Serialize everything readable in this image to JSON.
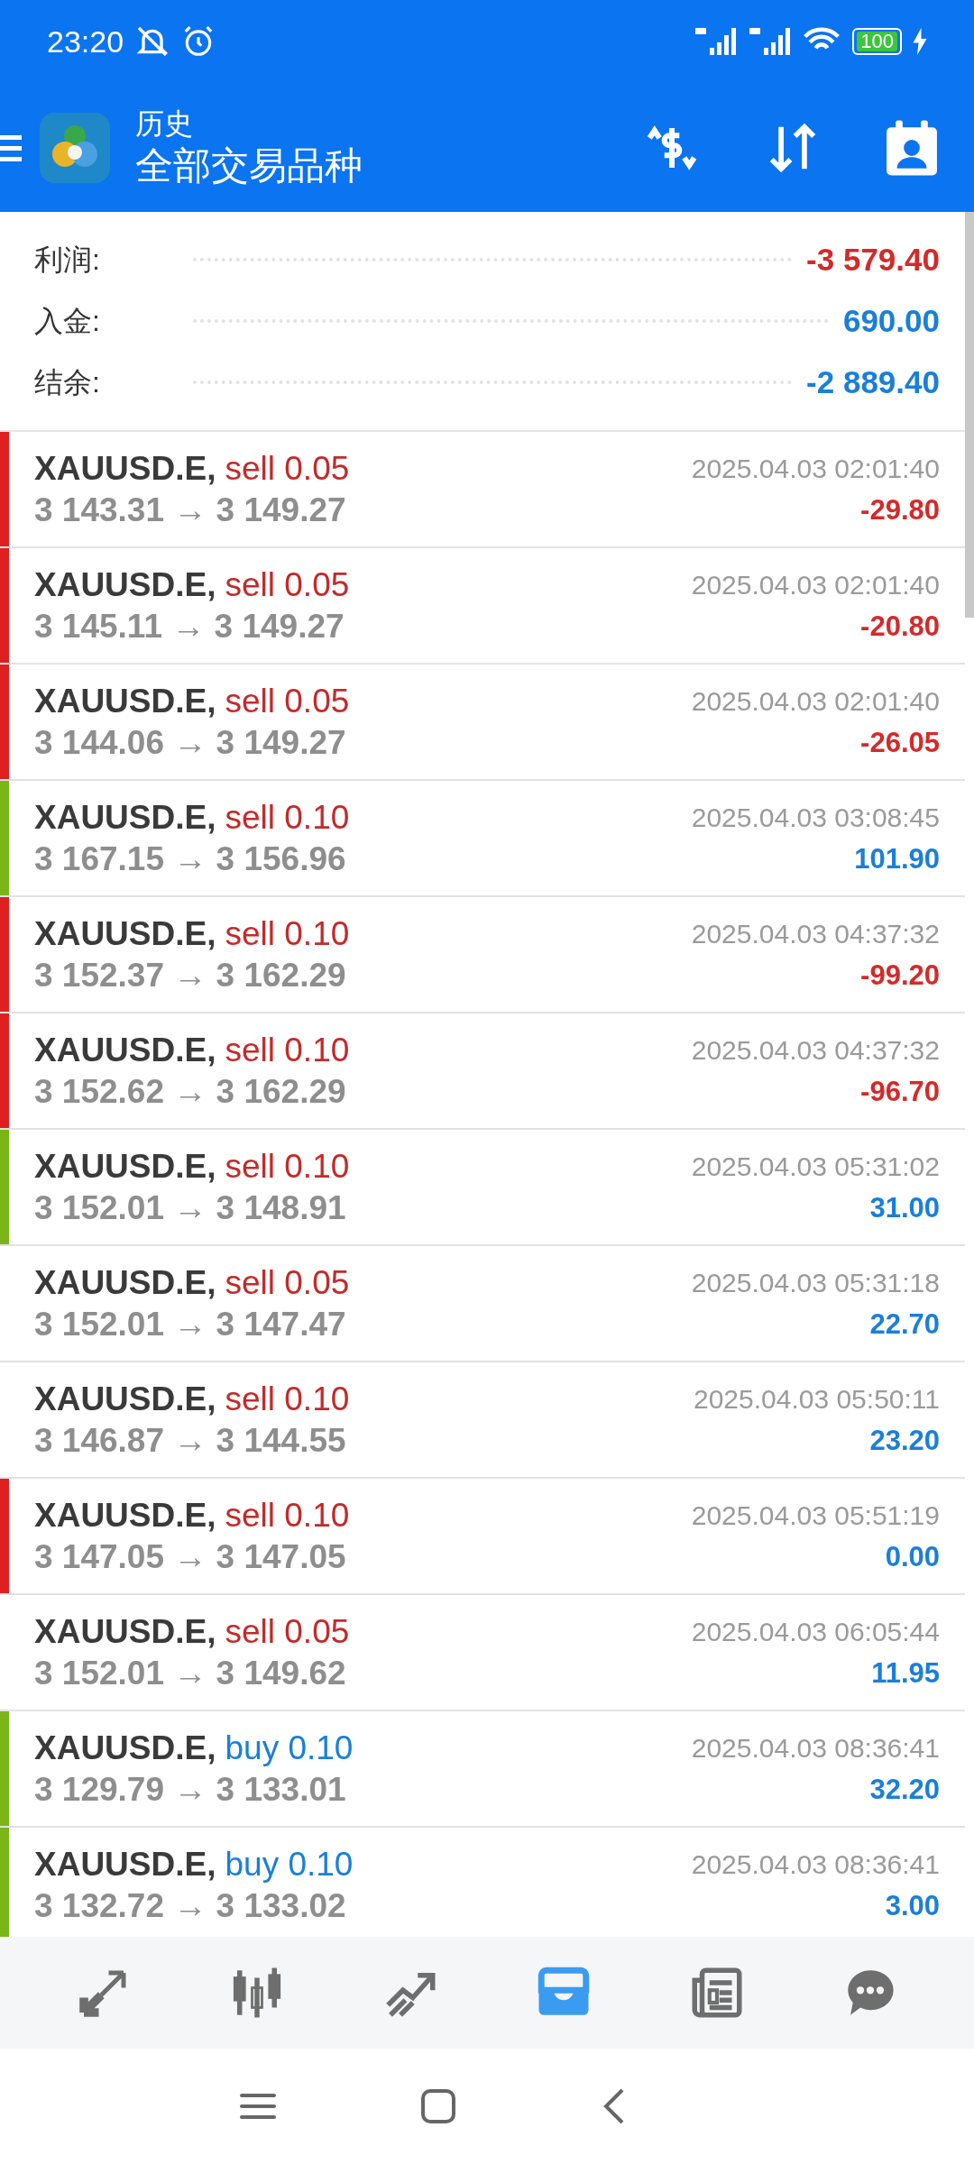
{
  "status_bar": {
    "time": "23:20",
    "battery": "100"
  },
  "header": {
    "subtitle": "历史",
    "title": "全部交易品种"
  },
  "summary": [
    {
      "label": "利润:",
      "value": {
        "text": "-3 579.40",
        "color": "#d42a2a"
      }
    },
    {
      "label": "入金:",
      "value": {
        "text": "690.00",
        "color": "#1a7fd8"
      }
    },
    {
      "label": "结余:",
      "value": {
        "text": "-2 889.40",
        "color": "#1a7fd8"
      }
    }
  ],
  "deals": [
    {
      "marker": {
        "color": "#e02020"
      },
      "symbol": "XAUUSD.E,",
      "order": {
        "text": "sell 0.05",
        "color": "#c42a2a"
      },
      "prices": "3 143.31 → 3 149.27",
      "time": "2025.04.03 02:01:40",
      "profit": {
        "text": "-29.80",
        "color": "#d42a2a"
      }
    },
    {
      "marker": {
        "color": "#e02020"
      },
      "symbol": "XAUUSD.E,",
      "order": {
        "text": "sell 0.05",
        "color": "#c42a2a"
      },
      "prices": "3 145.11 → 3 149.27",
      "time": "2025.04.03 02:01:40",
      "profit": {
        "text": "-20.80",
        "color": "#d42a2a"
      }
    },
    {
      "marker": {
        "color": "#e02020"
      },
      "symbol": "XAUUSD.E,",
      "order": {
        "text": "sell 0.05",
        "color": "#c42a2a"
      },
      "prices": "3 144.06 → 3 149.27",
      "time": "2025.04.03 02:01:40",
      "profit": {
        "text": "-26.05",
        "color": "#d42a2a"
      }
    },
    {
      "marker": {
        "color": "#7cb518"
      },
      "symbol": "XAUUSD.E,",
      "order": {
        "text": "sell 0.10",
        "color": "#c42a2a"
      },
      "prices": "3 167.15 → 3 156.96",
      "time": "2025.04.03 03:08:45",
      "profit": {
        "text": "101.90",
        "color": "#1a7fd8"
      }
    },
    {
      "marker": {
        "color": "#e02020"
      },
      "symbol": "XAUUSD.E,",
      "order": {
        "text": "sell 0.10",
        "color": "#c42a2a"
      },
      "prices": "3 152.37 → 3 162.29",
      "time": "2025.04.03 04:37:32",
      "profit": {
        "text": "-99.20",
        "color": "#d42a2a"
      }
    },
    {
      "marker": {
        "color": "#e02020"
      },
      "symbol": "XAUUSD.E,",
      "order": {
        "text": "sell 0.10",
        "color": "#c42a2a"
      },
      "prices": "3 152.62 → 3 162.29",
      "time": "2025.04.03 04:37:32",
      "profit": {
        "text": "-96.70",
        "color": "#d42a2a"
      }
    },
    {
      "marker": {
        "color": "#7cb518"
      },
      "symbol": "XAUUSD.E,",
      "order": {
        "text": "sell 0.10",
        "color": "#c42a2a"
      },
      "prices": "3 152.01 → 3 148.91",
      "time": "2025.04.03 05:31:02",
      "profit": {
        "text": "31.00",
        "color": "#1a7fd8"
      }
    },
    {
      "symbol": "XAUUSD.E,",
      "order": {
        "text": "sell 0.05",
        "color": "#c42a2a"
      },
      "prices": "3 152.01 → 3 147.47",
      "time": "2025.04.03 05:31:18",
      "profit": {
        "text": "22.70",
        "color": "#1a7fd8"
      }
    },
    {
      "symbol": "XAUUSD.E,",
      "order": {
        "text": "sell 0.10",
        "color": "#c42a2a"
      },
      "prices": "3 146.87 → 3 144.55",
      "time": "2025.04.03 05:50:11",
      "profit": {
        "text": "23.20",
        "color": "#1a7fd8"
      }
    },
    {
      "marker": {
        "color": "#e02020"
      },
      "symbol": "XAUUSD.E,",
      "order": {
        "text": "sell 0.10",
        "color": "#c42a2a"
      },
      "prices": "3 147.05 → 3 147.05",
      "time": "2025.04.03 05:51:19",
      "profit": {
        "text": "0.00",
        "color": "#1a7fd8"
      }
    },
    {
      "symbol": "XAUUSD.E,",
      "order": {
        "text": "sell 0.05",
        "color": "#c42a2a"
      },
      "prices": "3 152.01 → 3 149.62",
      "time": "2025.04.03 06:05:44",
      "profit": {
        "text": "11.95",
        "color": "#1a7fd8"
      }
    },
    {
      "marker": {
        "color": "#7cb518"
      },
      "symbol": "XAUUSD.E,",
      "order": {
        "text": "buy 0.10",
        "color": "#1a7fd8"
      },
      "prices": "3 129.79 → 3 133.01",
      "time": "2025.04.03 08:36:41",
      "profit": {
        "text": "32.20",
        "color": "#1a7fd8"
      }
    },
    {
      "marker": {
        "color": "#7cb518"
      },
      "symbol": "XAUUSD.E,",
      "order": {
        "text": "buy 0.10",
        "color": "#1a7fd8"
      },
      "prices": "3 132.72 → 3 133.02",
      "time": "2025.04.03 08:36:41",
      "profit": {
        "text": "3.00",
        "color": "#1a7fd8"
      }
    }
  ],
  "bottom_nav": [
    {
      "selected": false
    },
    {
      "selected": false
    },
    {
      "selected": false
    },
    {
      "selected": true
    },
    {
      "selected": false
    },
    {
      "selected": false
    }
  ]
}
